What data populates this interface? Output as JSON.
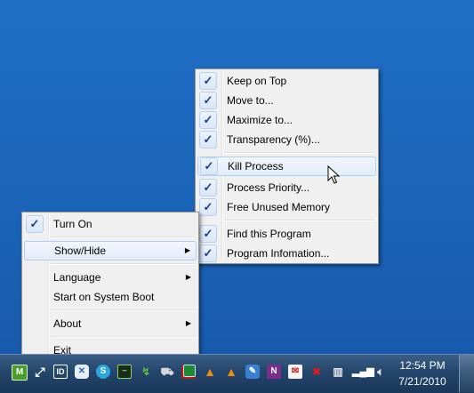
{
  "tray_menu": {
    "items": [
      {
        "label": "Turn On",
        "checked": true
      },
      {
        "label": "Show/Hide",
        "submenu": true,
        "highlighted": true
      },
      {
        "label": "Language",
        "submenu": true
      },
      {
        "label": "Start on System Boot"
      },
      {
        "label": "About",
        "submenu": true
      },
      {
        "label": "Exit"
      }
    ]
  },
  "window_menu": {
    "items": [
      {
        "label": "Keep on Top",
        "checked": true
      },
      {
        "label": "Move to...",
        "checked": true
      },
      {
        "label": "Maximize to...",
        "checked": true
      },
      {
        "label": "Transparency (%)...",
        "checked": true
      },
      {
        "label": "Kill Process",
        "checked": true,
        "highlighted": true
      },
      {
        "label": "Process Priority...",
        "checked": true
      },
      {
        "label": "Free Unused Memory",
        "checked": true
      },
      {
        "label": "Find this Program",
        "checked": true
      },
      {
        "label": "Program Infomation...",
        "checked": true
      }
    ]
  },
  "glyphs": {
    "check": "✓",
    "submenu_arrow": "▶"
  },
  "tray": {
    "id_icon_label": "ID",
    "n_icon_label": "N"
  },
  "clock": {
    "time": "12:54 PM",
    "date": "7/21/2010"
  },
  "colors": {
    "desktop": "#1a63b8",
    "menu_bg": "#f0f0f0",
    "highlight_border": "#aecff7",
    "check_color": "#1a3f8e"
  }
}
